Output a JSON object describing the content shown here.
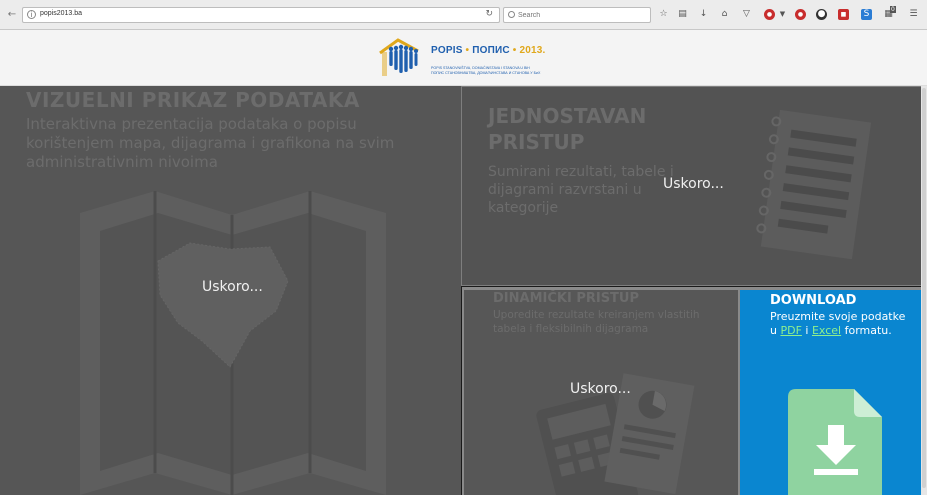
{
  "browser": {
    "url": "popis2013.ba",
    "search_placeholder": "Search",
    "badge_count": "0"
  },
  "header": {
    "logo_title_part1": "POPIS",
    "logo_title_dot1": " • ",
    "logo_title_part2": "ПОПИС",
    "logo_title_dot2": " • ",
    "logo_title_year": "2013.",
    "logo_subtitle_line1": "POPIS STANOVNIŠTVA, DOMAĆINSTAVA I STANOVA U BiH",
    "logo_subtitle_line2": "ПОПИС СТАНОВНИШТВА, ДОМАЋИНСТАВА И СТАНОВА У БиХ"
  },
  "panels": {
    "visual": {
      "title": "VIZUELNI PRIKAZ PODATAKA",
      "description": "Interaktivna prezentacija podataka o popisu korištenjem mapa, dijagrama i grafikona na svim administrativnim nivoima",
      "overlay": "Uskoro..."
    },
    "simple": {
      "title_line1": "JEDNOSTAVAN",
      "title_line2": "PRISTUP",
      "description": "Sumirani rezultati, tabele i dijagrami razvrstani u kategorije",
      "overlay": "Uskoro..."
    },
    "dynamic": {
      "title": "DINAMIČKI PRISTUP",
      "description": "Uporedite rezultate kreiranjem vlastitih tabela i fleksibilnih dijagrama",
      "overlay": "Uskoro..."
    },
    "download": {
      "title": "DOWNLOAD",
      "text_before": "Preuzmite svoje podatke u ",
      "pdf_link": "PDF",
      "text_middle": " i ",
      "excel_link": "Excel",
      "text_after": " formatu."
    }
  },
  "colors": {
    "logo_blue": "#1f5fae",
    "logo_yellow": "#e0a81c",
    "download_bg": "#0a86d0",
    "panel_gray": "#565656",
    "link_green": "#8ef08e"
  }
}
